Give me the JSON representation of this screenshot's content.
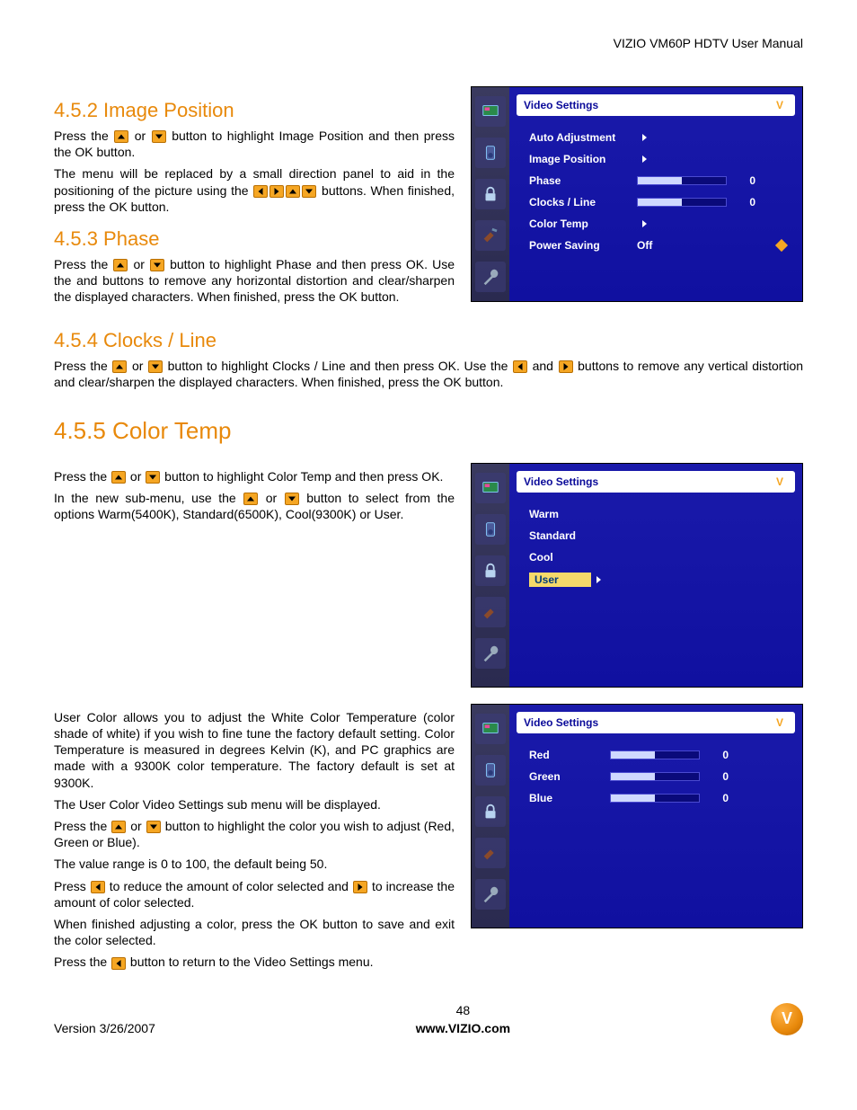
{
  "header": {
    "title": "VIZIO VM60P HDTV User Manual"
  },
  "sections": {
    "s1": {
      "heading": "4.5.2 Image Position",
      "p1a": "Press the ",
      "p1b": " or ",
      "p1c": " button to highlight Image Position and then press the OK button.",
      "p2a": "The menu will be replaced by a small direction panel to aid in the positioning of the picture using the ",
      "p2b": " buttons.  When finished, press the OK button."
    },
    "s2": {
      "heading": "4.5.3 Phase",
      "p1a": "Press the ",
      "p1b": " or ",
      "p1c": " button to highlight Phase and then press OK.  Use the        and        buttons to remove any horizontal distortion and clear/sharpen the displayed characters.  When finished, press the OK button."
    },
    "s3": {
      "heading": "4.5.4 Clocks / Line",
      "p1a": "Press the ",
      "p1b": " or ",
      "p1c": " button to highlight Clocks / Line and then press OK.  Use the ",
      "p1d": " and ",
      "p1e": " buttons to remove any vertical distortion and clear/sharpen the displayed characters.  When finished, press the OK button."
    },
    "s4": {
      "heading": "4.5.5 Color Temp",
      "p1a": "Press the ",
      "p1b": " or ",
      "p1c": " button to highlight Color Temp and then press OK.",
      "p2a": "In the new sub-menu, use the ",
      "p2b": " or ",
      "p2c": " button to select from the options Warm(5400K), Standard(6500K), Cool(9300K) or User.",
      "p3": "User Color allows you to adjust the White Color Temperature (color shade of white) if you wish to fine tune the factory default setting.  Color Temperature is measured in degrees Kelvin (K), and PC graphics are made with a 9300K color temperature.  The factory default is set at 9300K.",
      "p4": "The User Color Video Settings sub menu will be displayed.",
      "p5a": "Press the ",
      "p5b": " or ",
      "p5c": " button to highlight the color you wish to adjust (Red, Green or Blue).",
      "p6": "The value range is 0 to 100, the default being 50.",
      "p7a": "Press ",
      "p7b": " to reduce the amount of color selected and ",
      "p7c": " to increase the amount of color selected.",
      "p8": "When finished adjusting a color, press the OK button to save and exit the color selected.",
      "p9a": "Press the ",
      "p9b": " button to return to the Video Settings menu."
    }
  },
  "osd1": {
    "title": "Video Settings",
    "rows": {
      "r1": "Auto Adjustment",
      "r2": "Image Position",
      "r3": "Phase",
      "r3v": "0",
      "r4": "Clocks / Line",
      "r4v": "0",
      "r5": "Color  Temp",
      "r6": "Power Saving",
      "r6v": "Off"
    }
  },
  "osd2": {
    "title": "Video Settings",
    "rows": {
      "r1": "Warm",
      "r2": "Standard",
      "r3": "Cool",
      "r4": "User"
    }
  },
  "osd3": {
    "title": "Video Settings",
    "rows": {
      "r1": "Red",
      "r1v": "0",
      "r2": "Green",
      "r2v": "0",
      "r3": "Blue",
      "r3v": "0"
    }
  },
  "footer": {
    "version": "Version 3/26/2007",
    "page": "48",
    "url": "www.VIZIO.com",
    "logo": "V"
  }
}
